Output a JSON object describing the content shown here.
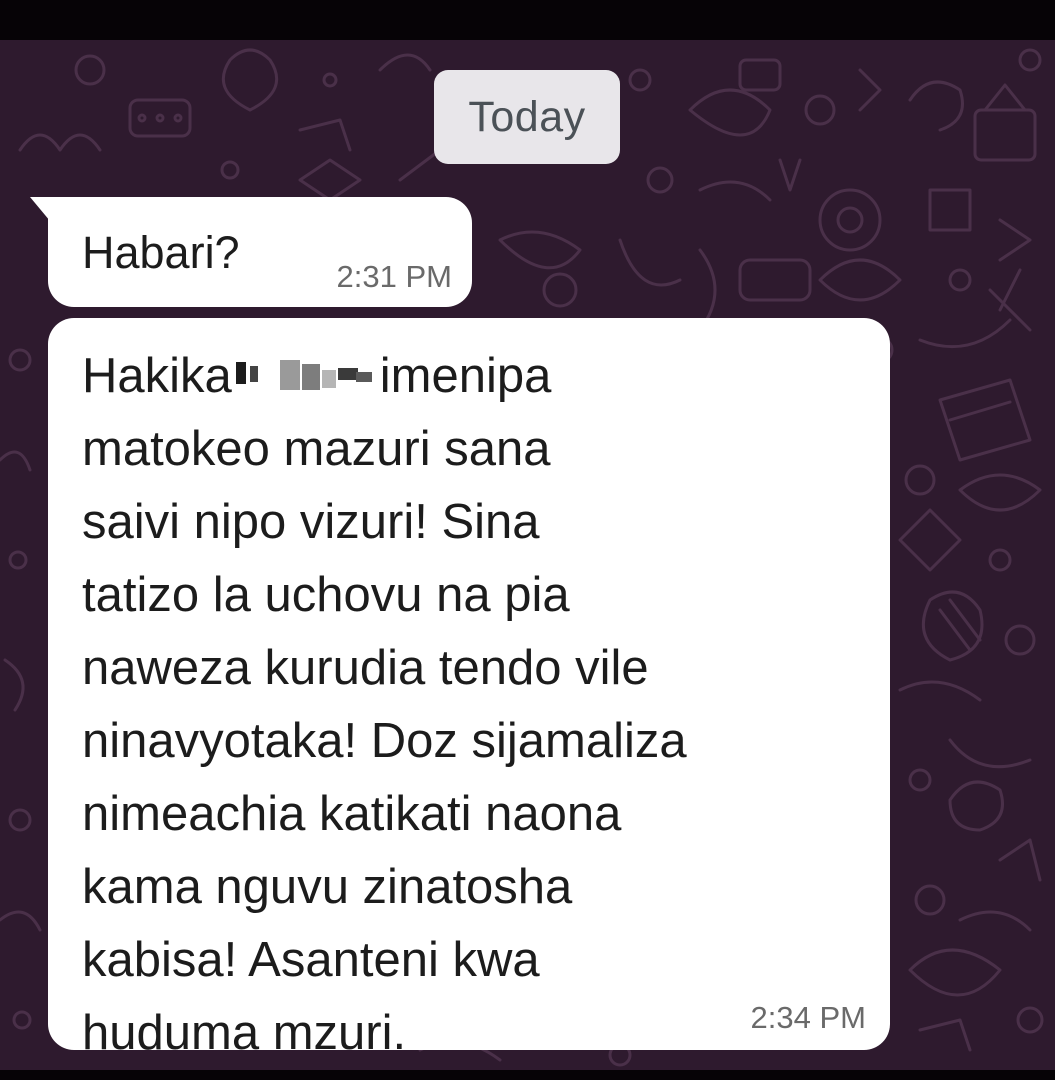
{
  "chat": {
    "date_separator": "Today",
    "messages": [
      {
        "text": "Habari?",
        "time": "2:31 PM"
      },
      {
        "lines": [
          "Hakika",
          "imenipa",
          "matokeo mazuri sana",
          "saivi nipo vizuri! Sina",
          "tatizo la uchovu na pia",
          "naweza kurudia tendo vile",
          "ninavyotaka! Doz sijamaliza",
          "nimeachia katikati naona",
          "kama nguvu zinatosha",
          "kabisa! Asanteni kwa",
          "huduma mzuri."
        ],
        "time": "2:34 PM"
      }
    ]
  },
  "colors": {
    "wallpaper": "#2e1a2e",
    "doodle": "#4a3049",
    "bubble": "#ffffff",
    "text": "#1c1c1c",
    "timestamp": "#6a6a6a",
    "date_chip": "#e8e6ea"
  }
}
